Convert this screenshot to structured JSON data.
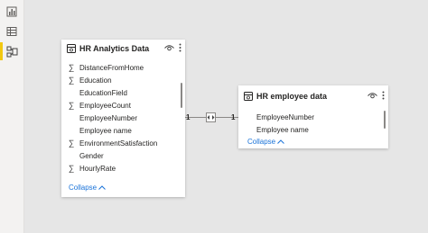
{
  "left_rail": {
    "icons": [
      "report-view-icon",
      "data-view-icon",
      "model-view-icon"
    ]
  },
  "tables": [
    {
      "title": "HR Analytics Data",
      "fields": [
        {
          "name": "DistanceFromHome",
          "sigma": true
        },
        {
          "name": "Education",
          "sigma": true
        },
        {
          "name": "EducationField",
          "sigma": false
        },
        {
          "name": "EmployeeCount",
          "sigma": true
        },
        {
          "name": "EmployeeNumber",
          "sigma": false
        },
        {
          "name": "Employee name",
          "sigma": false
        },
        {
          "name": "EnvironmentSatisfaction",
          "sigma": true
        },
        {
          "name": "Gender",
          "sigma": false
        },
        {
          "name": "HourlyRate",
          "sigma": true
        }
      ],
      "collapse_label": "Collapse"
    },
    {
      "title": "HR employee data",
      "fields": [
        {
          "name": "EmployeeNumber",
          "sigma": false
        },
        {
          "name": "Employee name",
          "sigma": false
        }
      ],
      "collapse_label": "Collapse"
    }
  ],
  "relationship": {
    "from_cardinality": "1",
    "to_cardinality": "1",
    "direction": "both"
  },
  "colors": {
    "accent_bar": "#f2c811",
    "link": "#1a73d9"
  }
}
